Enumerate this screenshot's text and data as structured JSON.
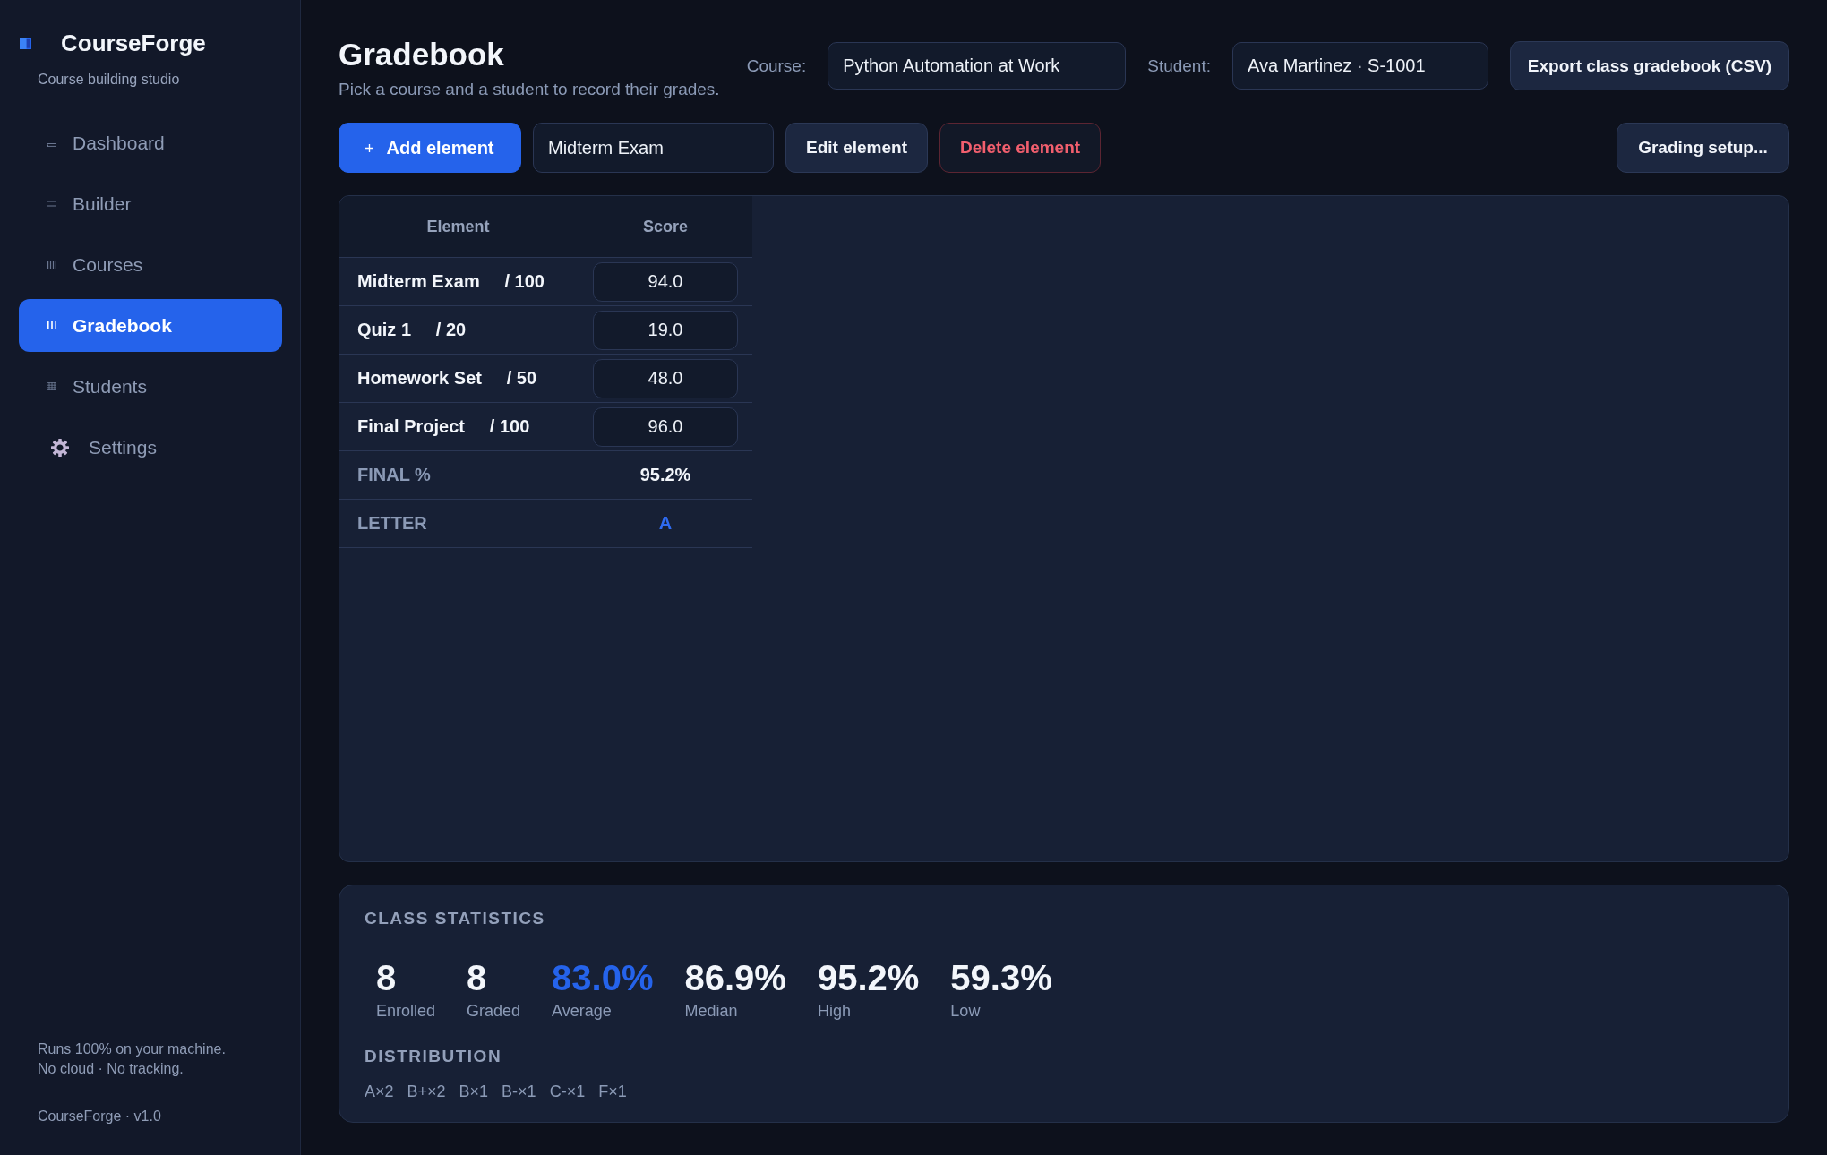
{
  "sidebar": {
    "app_name": "CourseForge",
    "tagline": "Course building studio",
    "items": [
      {
        "label": "Dashboard",
        "selected": false
      },
      {
        "label": "Builder",
        "selected": false
      },
      {
        "label": "Courses",
        "selected": false
      },
      {
        "label": "Gradebook",
        "selected": true
      },
      {
        "label": "Students",
        "selected": false
      },
      {
        "label": "Settings",
        "selected": false
      }
    ],
    "footer_lines": [
      "Runs 100% on your machine.",
      "No cloud · No tracking."
    ],
    "version": "CourseForge · v1.0"
  },
  "header": {
    "title": "Gradebook",
    "subtitle": "Pick a course and a student to record their grades.",
    "course": {
      "label": "Course:",
      "value": "Python Automation at Work"
    },
    "student": {
      "label": "Student:",
      "value": "Ava Martinez · S-1001"
    },
    "export_button": "Export class gradebook (CSV)"
  },
  "toolbar": {
    "add_button": "Add element",
    "element_field": {
      "value": "Midterm Exam"
    },
    "edit_button": "Edit element",
    "delete_button": "Delete element",
    "setup_button": "Grading setup..."
  },
  "table": {
    "columns": [
      "Element",
      "Score"
    ],
    "rows": [
      {
        "kind": "score",
        "element": "Midterm Exam     / 100",
        "score": "94.0"
      },
      {
        "kind": "score",
        "element": "Quiz 1     / 20",
        "score": "19.0"
      },
      {
        "kind": "score",
        "element": "Homework Set     / 50",
        "score": "48.0"
      },
      {
        "kind": "score",
        "element": "Final Project     / 100",
        "score": "96.0"
      },
      {
        "kind": "total",
        "element": "FINAL %",
        "score": "95.2%"
      },
      {
        "kind": "letter",
        "element": "LETTER",
        "score": "A"
      }
    ]
  },
  "class_statistics": {
    "title": "CLASS STATISTICS",
    "stats": [
      {
        "value": "8",
        "label": "Enrolled",
        "highlighted": false
      },
      {
        "value": "8",
        "label": "Graded",
        "highlighted": false
      },
      {
        "value": "83.0%",
        "label": "Average",
        "highlighted": true
      },
      {
        "value": "86.9%",
        "label": "Median",
        "highlighted": false
      },
      {
        "value": "95.2%",
        "label": "High",
        "highlighted": false
      },
      {
        "value": "59.3%",
        "label": "Low",
        "highlighted": false
      }
    ],
    "distribution_title": "DISTRIBUTION",
    "distribution": [
      "A×2",
      "B+×2",
      "B×1",
      "B-×1",
      "C-×1",
      "F×1"
    ]
  }
}
